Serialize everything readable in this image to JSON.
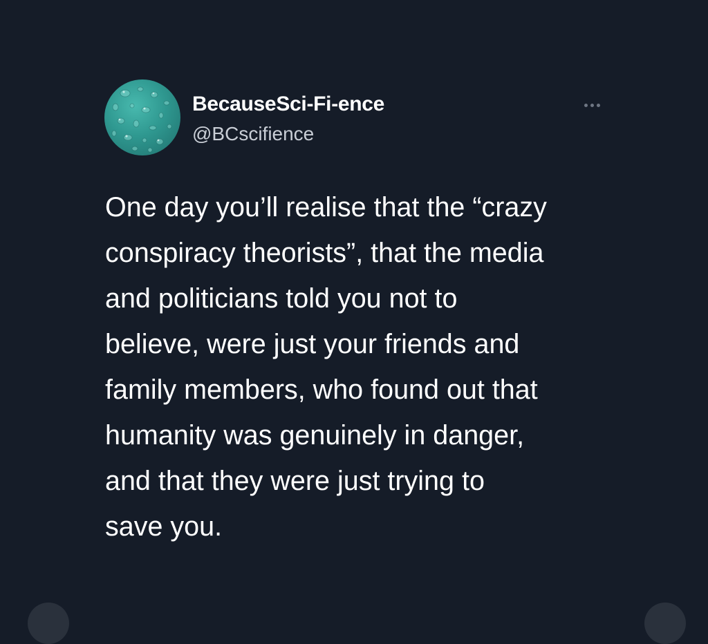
{
  "tweet": {
    "author": {
      "display_name": "BecauseSci-Fi-ence",
      "handle": "@BCscifience",
      "avatar_icon": "water-droplets-avatar"
    },
    "more_icon": "more-horizontal-icon",
    "text_lines": [
      "One day you’ll realise that the “crazy",
      "conspiracy theorists”, that the media",
      "and politicians told you not to",
      "believe, were just your friends and",
      "family members, who found out that",
      "humanity was genuinely in danger,",
      "and that they were just trying to",
      "save you."
    ]
  },
  "colors": {
    "background": "#151c28",
    "text": "#ffffff",
    "handle": "#c9ced6",
    "avatar": "#2f9890"
  }
}
